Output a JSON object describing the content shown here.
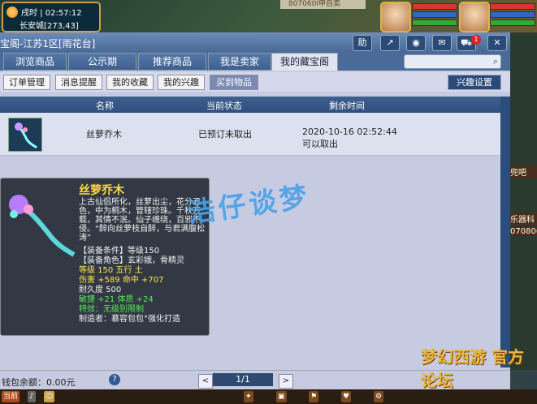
{
  "status_bar": {
    "time": "戌时 | 02:57:12",
    "location": "长安城[273,43]",
    "notice": "807060I申自卖"
  },
  "window": {
    "title": "宝阁-江苏1区[雨花台]",
    "toolbar": {
      "assist_label": "助",
      "cart_badge": "1"
    }
  },
  "tabs": [
    {
      "label": "浏览商品"
    },
    {
      "label": "公示期"
    },
    {
      "label": "推荐商品"
    },
    {
      "label": "我是卖家"
    },
    {
      "label": "我的藏宝阁",
      "active": true
    }
  ],
  "search": {
    "placeholder": ""
  },
  "subnav": {
    "buttons": [
      {
        "label": "订单管理"
      },
      {
        "label": "消息提醒"
      },
      {
        "label": "我的收藏"
      },
      {
        "label": "我的兴趣"
      },
      {
        "label": "买到物品",
        "active": true
      }
    ],
    "interest_settings": "兴趣设置"
  },
  "table": {
    "headers": [
      "名称",
      "当前状态",
      "剩余时间"
    ],
    "rows": [
      {
        "name": "丝萝乔木",
        "status": "已预订未取出",
        "remaining": "2020-10-16 02:52:44",
        "remaining_note": "可以取出"
      }
    ]
  },
  "tooltip": {
    "name": "丝萝乔木",
    "description": "上古仙侣所化，丝萝出尘，花分五色，中为桐木，管辖珍珠。千秋万载，其情不泯。仙子缠绕，百邪不侵。“醉向丝萝枝自醉，与君满腹松涛”",
    "equip_condition": "【装备条件】等级150",
    "equip_role": "【装备角色】玄彩娥，骨精灵",
    "level_line": "等级 150  五行 土",
    "damage_line": "伤害 +589  命中 +707",
    "durability": "耐久度 500",
    "agility_line": "敏捷 +21  体质 +24",
    "special_effect": "特效：无级别限制",
    "maker": "制造者：慕容包包°强化打造"
  },
  "watermark": "浩仔谈梦",
  "footer": {
    "balance": "钱包余额：0.00元",
    "help": "?",
    "prev": "<",
    "next": ">",
    "page": "1/1"
  },
  "right_panel": {
    "items": [
      "乐器科",
      "07080(",
      "兜吧"
    ]
  },
  "bottom": {
    "action": "当前"
  },
  "logo": "梦幻西游 官方论坛"
}
